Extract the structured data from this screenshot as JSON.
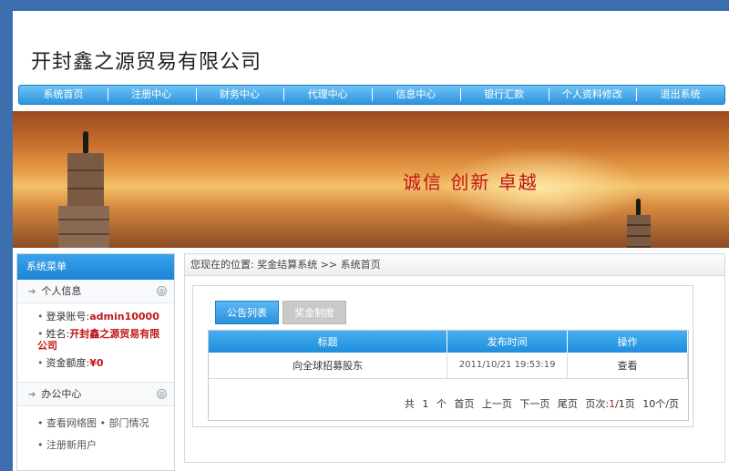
{
  "site": {
    "title": "开封鑫之源贸易有限公司"
  },
  "nav": [
    {
      "label": "系统首页"
    },
    {
      "label": "注册中心"
    },
    {
      "label": "财务中心"
    },
    {
      "label": "代理中心"
    },
    {
      "label": "信息中心"
    },
    {
      "label": "银行汇款"
    },
    {
      "label": "个人资料修改"
    },
    {
      "label": "退出系统"
    }
  ],
  "banner": {
    "slogan": "诚信 创新 卓越"
  },
  "sidebar": {
    "header": "系统菜单",
    "personal": {
      "title": "个人信息",
      "login_label": "登录账号:",
      "login_value": "admin10000",
      "name_label": "姓名:",
      "name_value": "开封鑫之源贸易有限公司",
      "balance_label": "资金额度:",
      "balance_value": "¥0"
    },
    "office": {
      "title": "办公中心",
      "link1": "查看网络图",
      "link2": "部门情况",
      "link3": "注册新用户"
    },
    "toggle_glyph": "◎",
    "arrow_glyph": "➔"
  },
  "main": {
    "breadcrumb": "您现在的位置: 奖金结算系统 >> 系统首页",
    "tabs": [
      {
        "label": "公告列表"
      },
      {
        "label": "奖金制度"
      }
    ],
    "table": {
      "headers": [
        "标题",
        "发布时间",
        "操作"
      ],
      "rows": [
        {
          "title": "向全球招募股东",
          "date": "2011/10/21 19:53:19",
          "action": "查看"
        }
      ]
    },
    "pager": {
      "total_prefix": "共",
      "total": "1",
      "total_suffix": "个",
      "first": "首页",
      "prev": "上一页",
      "next": "下一页",
      "last": "尾页",
      "page_label": "页次:",
      "page_current": "1",
      "page_total": "/1页",
      "per_page": "10个/页"
    }
  },
  "colors": {
    "accent": "#2d94de",
    "banner_text": "#c0141a",
    "page_bg": "#3d6fae"
  }
}
